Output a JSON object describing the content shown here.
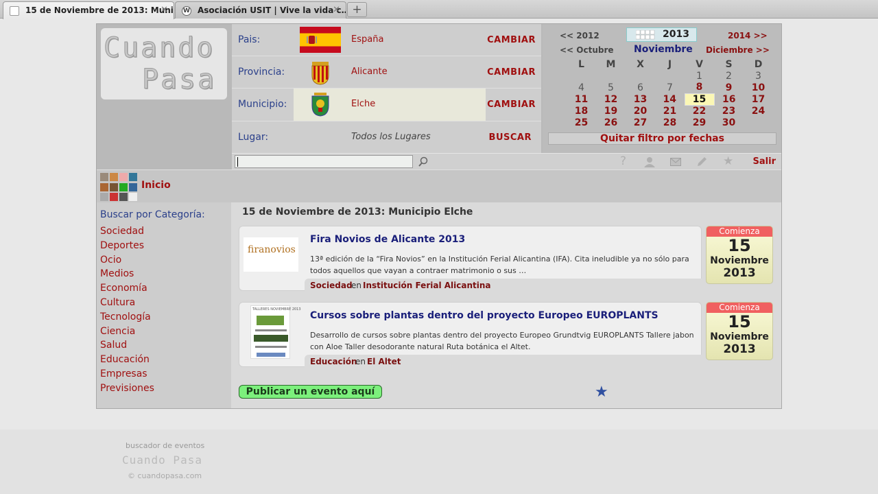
{
  "browser": {
    "tabs": [
      {
        "title": "15 de Noviembre de 2013: Muni…",
        "active": true
      },
      {
        "title": "Asociación USIT | Vive la vida c…",
        "active": false
      }
    ],
    "new_tab": "+",
    "close": "✕"
  },
  "logo": {
    "line1": "Cuando",
    "line2": "Pasa"
  },
  "location": {
    "rows": [
      {
        "label": "Pais:",
        "value": "España",
        "action": "CAMBIAR"
      },
      {
        "label": "Provincia:",
        "value": "Alicante",
        "action": "CAMBIAR"
      },
      {
        "label": "Municipio:",
        "value": "Elche",
        "action": "CAMBIAR"
      },
      {
        "label": "Lugar:",
        "value": "Todos los Lugares",
        "action": "BUSCAR"
      }
    ]
  },
  "calendar": {
    "prev_year": "<< 2012",
    "year": "2013",
    "next_year": "2014 >>",
    "prev_month": "<< Octubre",
    "month": "Noviembre",
    "next_month": "Diciembre >>",
    "weekdays": [
      "L",
      "M",
      "X",
      "J",
      "V",
      "S",
      "D"
    ],
    "weeks": [
      [
        "",
        "",
        "",
        "",
        "1",
        "2",
        "3"
      ],
      [
        "4",
        "5",
        "6",
        "7",
        "8",
        "9",
        "10"
      ],
      [
        "11",
        "12",
        "13",
        "14",
        "15",
        "16",
        "17"
      ],
      [
        "18",
        "19",
        "20",
        "21",
        "22",
        "23",
        "24"
      ],
      [
        "25",
        "26",
        "27",
        "28",
        "29",
        "30",
        ""
      ]
    ],
    "today": "15",
    "clear_filter": "Quitar filtro por fechas"
  },
  "toolbar": {
    "search_value": "",
    "icons": [
      "search-icon",
      "help-icon",
      "user-icon",
      "mail-icon",
      "pencil-icon",
      "star-icon"
    ],
    "logout": "Salir"
  },
  "nav": {
    "home": "Inicio"
  },
  "sidebar": {
    "title": "Buscar por Categoría:",
    "categories": [
      "Sociedad",
      "Deportes",
      "Ocio",
      "Medios",
      "Economía",
      "Cultura",
      "Tecnología",
      "Ciencia",
      "Salud",
      "Educación",
      "Empresas",
      "Previsiones"
    ]
  },
  "main": {
    "title": "15 de Noviembre de 2013: Municipio Elche",
    "events": [
      {
        "thumb_text": "firanovios",
        "title": "Fira Novios de Alicante 2013",
        "description": "13ª edición de la “Fira Novios” en la Institución Ferial Alicantina (IFA). Cita ineludible ya no sólo para todos aquellos que vayan a contraer matrimonio o sus …",
        "category": "Sociedad",
        "connector": "en",
        "place": "Institución Ferial Alicantina",
        "badge": {
          "label": "Comienza",
          "day": "15",
          "month": "Noviembre",
          "year": "2013"
        }
      },
      {
        "thumb_text": "TALLERES NOVIEMBRE 2013",
        "title": "Cursos sobre plantas dentro del proyecto Europeo EUROPLANTS",
        "description": "Desarrollo de cursos sobre plantas dentro del proyecto Europeo Grundtvig EUROPLANTS Tallere jabon con Aloe Taller desodorante natural Ruta botánica el Altet.",
        "category": "Educación",
        "connector": "en",
        "place": "El Altet",
        "badge": {
          "label": "Comienza",
          "day": "15",
          "month": "Noviembre",
          "year": "2013"
        }
      }
    ],
    "publish": "Publicar un evento aquí",
    "star": "★"
  },
  "footer": {
    "line1": "buscador de eventos",
    "line2": "Cuando Pasa",
    "line3": "© cuandopasa.com"
  },
  "colors": {
    "accent_red": "#a01010",
    "nav_blue": "#1a1f7a",
    "publish_green": "#7cf07c",
    "badge_header": "#f06060"
  }
}
